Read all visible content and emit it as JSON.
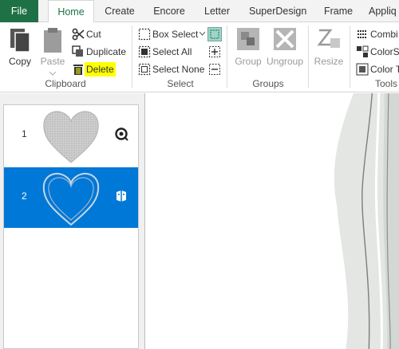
{
  "tabs": {
    "file": "File",
    "home": "Home",
    "create": "Create",
    "encore": "Encore",
    "letter": "Letter",
    "superdesign": "SuperDesign",
    "frame": "Frame",
    "appliq": "Appliq"
  },
  "clipboard": {
    "copy": "Copy",
    "paste": "Paste",
    "cut": "Cut",
    "duplicate": "Duplicate",
    "delete": "Delete",
    "group_label": "Clipboard"
  },
  "select": {
    "box_select": "Box Select",
    "select_all": "Select All",
    "select_none": "Select None",
    "group_label": "Select"
  },
  "groups": {
    "group": "Group",
    "ungroup": "Ungroup",
    "group_label": "Groups"
  },
  "resize": {
    "label": "Resize"
  },
  "tools": {
    "combine": "Combi",
    "colorsort": "ColorS",
    "colortools": "Color T",
    "group_label": "Tools"
  },
  "object_list": [
    {
      "number": "1",
      "selected": false,
      "badge_icon": "search-zoom-icon"
    },
    {
      "number": "2",
      "selected": true,
      "badge_icon": "applique-icon"
    }
  ],
  "colors": {
    "file_tab": "#1e7145",
    "selection": "#0078d7",
    "highlight": "#ffff00"
  }
}
